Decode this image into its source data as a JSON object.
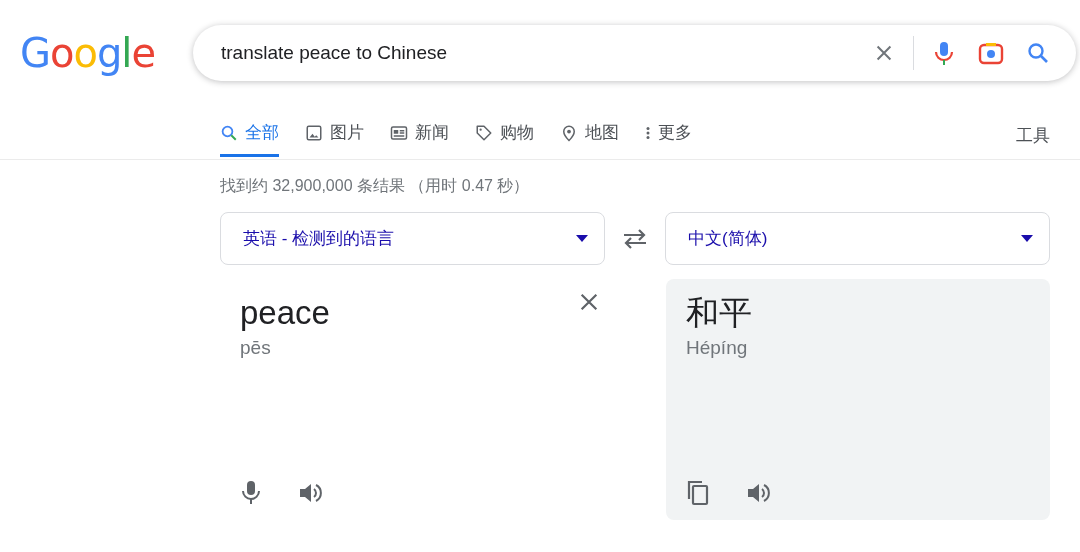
{
  "logo": "Google",
  "search": {
    "value": "translate peace to Chinese"
  },
  "tabs": [
    {
      "label": "全部",
      "kind": "search",
      "selected": true
    },
    {
      "label": "图片",
      "kind": "image",
      "selected": false
    },
    {
      "label": "新闻",
      "kind": "news",
      "selected": false
    },
    {
      "label": "购物",
      "kind": "tag",
      "selected": false
    },
    {
      "label": "地图",
      "kind": "pin",
      "selected": false
    },
    {
      "label": "更多",
      "kind": "dots",
      "selected": false
    }
  ],
  "tools": "工具",
  "result_stats": "找到约 32,900,000 条结果 （用时 0.47 秒）",
  "translator": {
    "source_language": "英语 - 检测到的语言",
    "target_language": "中文(简体)",
    "source_text": "peace",
    "source_phonetic": "pēs",
    "target_text": "和平",
    "target_phonetic": "Hépíng"
  }
}
